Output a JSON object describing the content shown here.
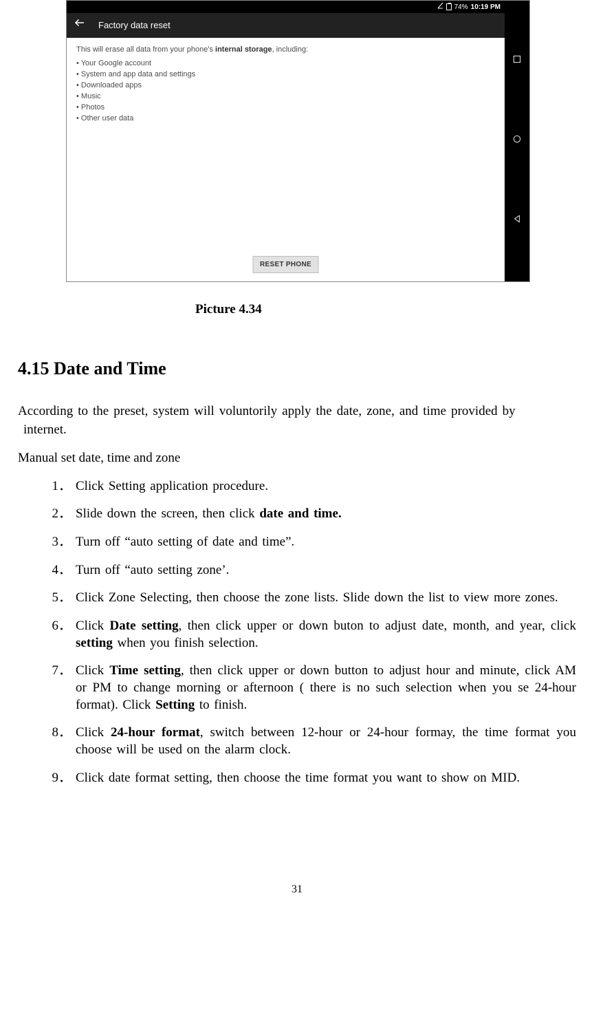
{
  "screenshot": {
    "status_bar": {
      "battery_pct": "74%",
      "time": "10:19 PM"
    },
    "header_title": "Factory data reset",
    "intro_prefix": "This will erase all data from your phone's ",
    "intro_bold": "internal storage",
    "intro_suffix": ", including:",
    "bullets": [
      "Your Google account",
      "System and app data and settings",
      "Downloaded apps",
      "Music",
      "Photos",
      "Other user data"
    ],
    "reset_button": "RESET PHONE"
  },
  "caption": "Picture 4.34",
  "section_heading": "4.15 Date and Time",
  "intro_paragraph_line1": "According to the preset, system will voluntorily apply the date, zone, and time provided by",
  "intro_paragraph_line2": "internet.",
  "manual_intro": "Manual set date, time and zone",
  "steps": [
    {
      "n": "1．",
      "segments": [
        {
          "t": "Click Setting application procedure."
        }
      ]
    },
    {
      "n": "2．",
      "segments": [
        {
          "t": "Slide down the screen, then click "
        },
        {
          "t": "date and time.",
          "b": true
        }
      ]
    },
    {
      "n": "3．",
      "segments": [
        {
          "t": "Turn off “auto setting of date and time”."
        }
      ]
    },
    {
      "n": "4．",
      "segments": [
        {
          "t": "Turn off “auto setting zone’."
        }
      ]
    },
    {
      "n": "5．",
      "segments": [
        {
          "t": "Click Zone Selecting, then choose the zone lists. Slide down the list to view more zones."
        }
      ]
    },
    {
      "n": "6．",
      "segments": [
        {
          "t": "Click "
        },
        {
          "t": "Date setting",
          "b": true
        },
        {
          "t": ", then click upper or down buton to adjust date, month, and year, click "
        },
        {
          "t": "setting",
          "b": true
        },
        {
          "t": " when you finish selection."
        }
      ]
    },
    {
      "n": "7．",
      "segments": [
        {
          "t": "Click "
        },
        {
          "t": "Time setting",
          "b": true
        },
        {
          "t": ", then click upper or down button to adjust hour and minute, click AM or PM to change morning or afternoon ( there is no such selection when you se 24-hour format). Click "
        },
        {
          "t": "Setting",
          "b": true
        },
        {
          "t": " to finish."
        }
      ]
    },
    {
      "n": "8．",
      "segments": [
        {
          "t": "Click "
        },
        {
          "t": "24-hour format",
          "b": true
        },
        {
          "t": ", switch between 12-hour or 24-hour formay, the time format you choose will be used on the alarm clock."
        }
      ]
    },
    {
      "n": "9．",
      "segments": [
        {
          "t": "Click date format setting, then choose the time format you want to show on MID."
        }
      ]
    }
  ],
  "page_number": "31"
}
